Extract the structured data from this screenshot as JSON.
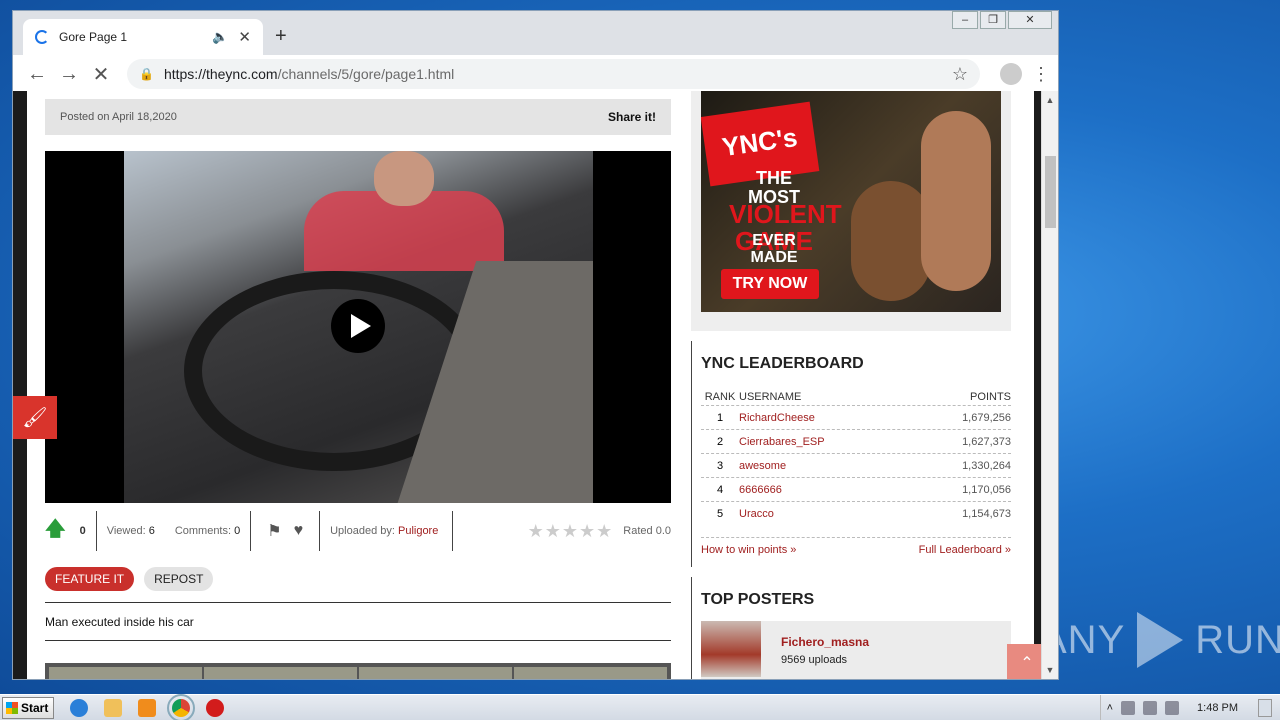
{
  "browser": {
    "tab_title": "Gore Page 1",
    "url_main": "https://theync.com",
    "url_path": "/channels/5/gore/page1.html",
    "icons": [
      "back-icon",
      "forward-icon",
      "stop-icon",
      "lock-icon",
      "star-icon",
      "profile-icon",
      "menu-icon"
    ]
  },
  "post": {
    "posted_on": "Posted on April 18,2020",
    "share": "Share it!",
    "votes": "0",
    "viewed_label": "Viewed:",
    "viewed_value": "6",
    "comments_label": "Comments:",
    "comments_value": "0",
    "uploaded_label": "Uploaded by:",
    "uploader": "Puligore",
    "rating_stars": "★★★★★",
    "rated": "Rated 0.0",
    "feature_btn": "FEATURE IT",
    "repost_btn": "REPOST",
    "description": "Man executed inside his car"
  },
  "ad": {
    "logo": "YNC's",
    "line1": "THE MOST",
    "line2": "VIOLENT GAME",
    "line3": "EVER MADE",
    "cta": "TRY NOW"
  },
  "leaderboard": {
    "title": "YNC LEADERBOARD",
    "col_rank": "RANK",
    "col_user": "USERNAME",
    "col_points": "POINTS",
    "rows": [
      {
        "rank": "1",
        "user": "RichardCheese",
        "points": "1,679,256"
      },
      {
        "rank": "2",
        "user": "Cierrabares_ESP",
        "points": "1,627,373"
      },
      {
        "rank": "3",
        "user": "awesome",
        "points": "1,330,264"
      },
      {
        "rank": "4",
        "user": "6666666",
        "points": "1,170,056"
      },
      {
        "rank": "5",
        "user": "Uracco",
        "points": "1,154,673"
      }
    ],
    "how_to_win": "How to win points »",
    "full": "Full Leaderboard »"
  },
  "top_posters": {
    "title": "TOP POSTERS",
    "name": "Fichero_masna",
    "uploads": "9569 uploads"
  },
  "taskbar": {
    "start": "Start",
    "clock": "1:48 PM"
  },
  "watermark": {
    "left": "ANY",
    "right": "RUN"
  }
}
